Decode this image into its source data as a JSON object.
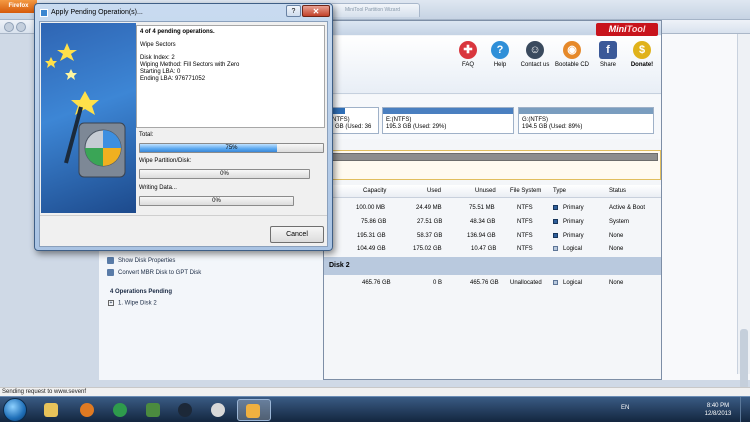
{
  "firefox": {
    "menu_label": "Firefox",
    "tab_label": "MiniTool Partition Wizard"
  },
  "app": {
    "logo_part1": "Mini",
    "logo_part2": "Tool",
    "toolbar": [
      {
        "label": "FAQ",
        "icon": "lifebuoy-icon",
        "color": "#d9363e"
      },
      {
        "label": "Help",
        "icon": "help-icon",
        "color": "#2f8fd8"
      },
      {
        "label": "Contact us",
        "icon": "contact-icon",
        "color": "#3a4a5e"
      },
      {
        "label": "Bootable CD",
        "icon": "bootable-cd-icon",
        "color": "#e6892a"
      },
      {
        "label": "Share",
        "icon": "facebook-icon",
        "color": "#3b5998"
      },
      {
        "label": "Donate!",
        "icon": "dollar-icon",
        "color": "#e0b21b"
      }
    ],
    "disk1_partitions": [
      {
        "line1": "(NTFS)",
        "line2": "9 GB (Used: 36"
      },
      {
        "line1": "E:(NTFS)",
        "line2": "195.3 GB (Used: 29%)"
      },
      {
        "line1": "G:(NTFS)",
        "line2": "194.5 GB (Used: 89%)"
      }
    ],
    "columns": {
      "capacity": "Capacity",
      "used": "Used",
      "unused": "Unused",
      "file_system": "File System",
      "type": "Type",
      "status": "Status"
    },
    "rows": [
      {
        "capacity": "100.00 MB",
        "used": "24.49 MB",
        "unused": "75.51 MB",
        "fs": "NTFS",
        "type": "Primary",
        "status": "Active & Boot"
      },
      {
        "capacity": "75.86 GB",
        "used": "27.51 GB",
        "unused": "48.34 GB",
        "fs": "NTFS",
        "type": "Primary",
        "status": "System"
      },
      {
        "capacity": "195.31 GB",
        "used": "58.37 GB",
        "unused": "136.94 GB",
        "fs": "NTFS",
        "type": "Primary",
        "status": "None"
      },
      {
        "capacity": "104.49 GB",
        "used": "175.02 GB",
        "unused": "10.47 GB",
        "fs": "NTFS",
        "type": "Logical",
        "status": "None"
      }
    ],
    "disk2_label": "Disk 2",
    "disk2_row": {
      "name": "*:",
      "capacity": "465.76 GB",
      "used": "0 B",
      "unused": "465.76 GB",
      "fs": "Unallocated",
      "type": "Logical",
      "status": "None"
    },
    "left_panel": {
      "show_disk_properties": "Show Disk Properties",
      "convert_mbr": "Convert MBR Disk to GPT Disk",
      "ops_pending": "4 Operations Pending",
      "op1": "1. Wipe Disk 2"
    }
  },
  "dialog": {
    "title": "Apply Pending Operation(s)...",
    "help": "?",
    "close": "✕",
    "ops_count": "4 of 4 pending operations.",
    "operation": "Wipe Sectors",
    "disk_index": "Disk Index: 2",
    "wiping_method": "Wiping Method: Fill Sectors with Zero",
    "starting_lba": "Starting LBA: 0",
    "ending_lba": "Ending LBA: 976771052",
    "total_label": "Total:",
    "total_pct": "75%",
    "total_value": 0.75,
    "wipe_label": "Wipe Partition/Disk:",
    "wipe_pct": "0%",
    "wipe_value": 0,
    "writing_label": "Writing Data...",
    "writing_pct": "0%",
    "writing_value": 0,
    "cancel": "Cancel"
  },
  "status": {
    "text": "Sending request to www.sevenf"
  },
  "taskbar": {
    "lang": "EN",
    "time": "8:40 PM",
    "date": "12/8/2013"
  }
}
